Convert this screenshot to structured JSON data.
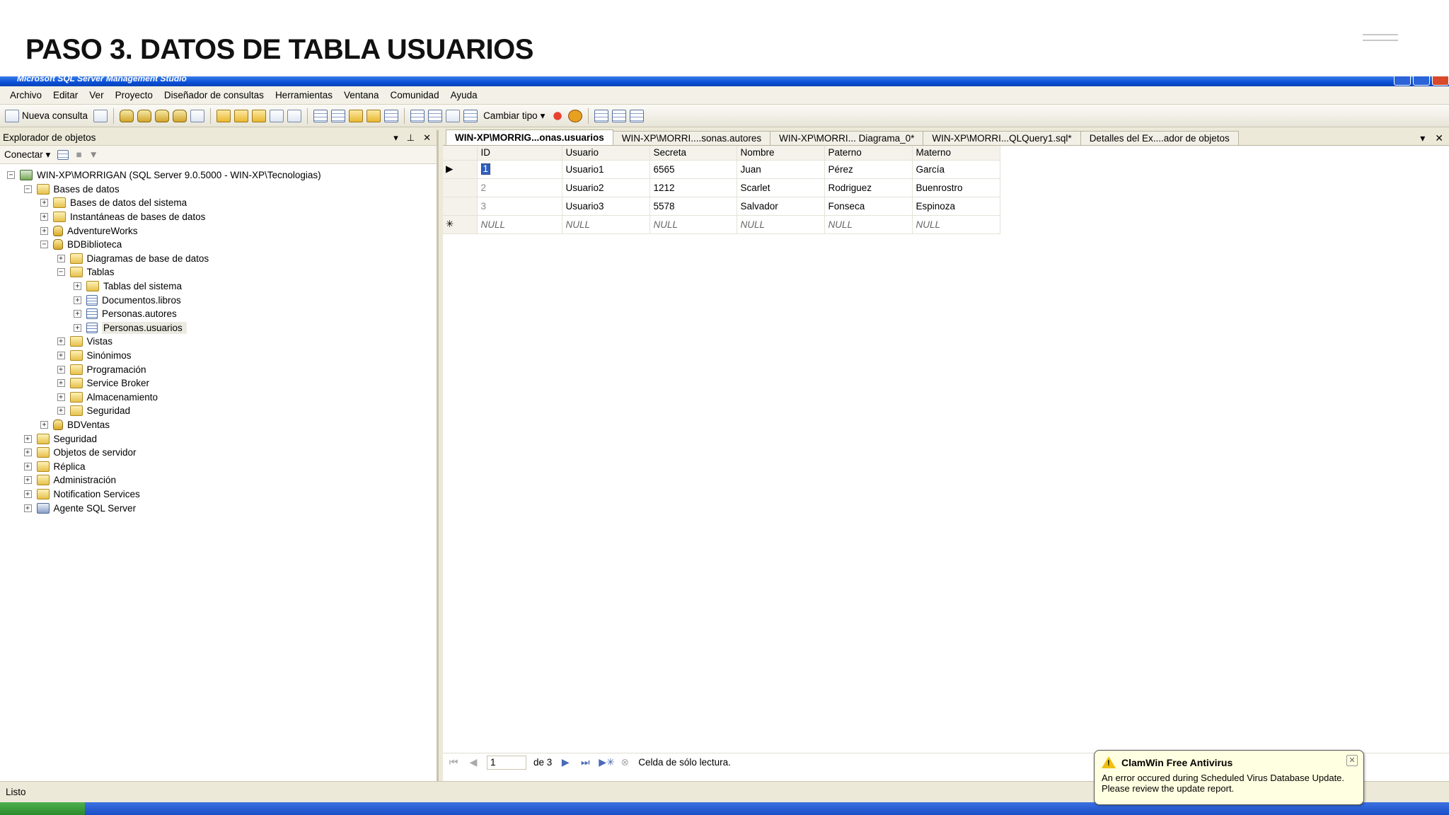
{
  "slide": {
    "title": "PASO 3. DATOS DE TABLA USUARIOS"
  },
  "window": {
    "title": "Microsoft SQL Server Management Studio"
  },
  "menu": [
    "Archivo",
    "Editar",
    "Ver",
    "Proyecto",
    "Diseñador de consultas",
    "Herramientas",
    "Ventana",
    "Comunidad",
    "Ayuda"
  ],
  "toolbar": {
    "new_query": "Nueva consulta",
    "change_type": "Cambiar tipo"
  },
  "object_explorer": {
    "title": "Explorador de objetos",
    "connect": "Conectar",
    "tree": [
      {
        "label": "WIN-XP\\MORRIGAN (SQL Server 9.0.5000 - WIN-XP\\Tecnologias)",
        "icon": "server",
        "level": 0,
        "exp": "−"
      },
      {
        "label": "Bases de datos",
        "icon": "folder",
        "level": 1,
        "exp": "−"
      },
      {
        "label": "Bases de datos del sistema",
        "icon": "folder",
        "level": 2,
        "exp": "+"
      },
      {
        "label": "Instantáneas de bases de datos",
        "icon": "folder",
        "level": 2,
        "exp": "+"
      },
      {
        "label": "AdventureWorks",
        "icon": "dbi",
        "level": 2,
        "exp": "+"
      },
      {
        "label": "BDBiblioteca",
        "icon": "dbi",
        "level": 2,
        "exp": "−"
      },
      {
        "label": "Diagramas de base de datos",
        "icon": "folder",
        "level": 3,
        "exp": "+"
      },
      {
        "label": "Tablas",
        "icon": "folder",
        "level": 3,
        "exp": "−"
      },
      {
        "label": "Tablas del sistema",
        "icon": "folder",
        "level": 4,
        "exp": "+"
      },
      {
        "label": "Documentos.libros",
        "icon": "table",
        "level": 4,
        "exp": "+"
      },
      {
        "label": "Personas.autores",
        "icon": "table",
        "level": 4,
        "exp": "+"
      },
      {
        "label": "Personas.usuarios",
        "icon": "table",
        "level": 4,
        "exp": "+",
        "selected": true
      },
      {
        "label": "Vistas",
        "icon": "folder",
        "level": 3,
        "exp": "+"
      },
      {
        "label": "Sinónimos",
        "icon": "folder",
        "level": 3,
        "exp": "+"
      },
      {
        "label": "Programación",
        "icon": "folder",
        "level": 3,
        "exp": "+"
      },
      {
        "label": "Service Broker",
        "icon": "folder",
        "level": 3,
        "exp": "+"
      },
      {
        "label": "Almacenamiento",
        "icon": "folder",
        "level": 3,
        "exp": "+"
      },
      {
        "label": "Seguridad",
        "icon": "folder",
        "level": 3,
        "exp": "+"
      },
      {
        "label": "BDVentas",
        "icon": "dbi",
        "level": 2,
        "exp": "+"
      },
      {
        "label": "Seguridad",
        "icon": "folder",
        "level": 1,
        "exp": "+"
      },
      {
        "label": "Objetos de servidor",
        "icon": "folder",
        "level": 1,
        "exp": "+"
      },
      {
        "label": "Réplica",
        "icon": "folder",
        "level": 1,
        "exp": "+"
      },
      {
        "label": "Administración",
        "icon": "folder",
        "level": 1,
        "exp": "+"
      },
      {
        "label": "Notification Services",
        "icon": "folder",
        "level": 1,
        "exp": "+"
      },
      {
        "label": "Agente SQL Server",
        "icon": "agent",
        "level": 1,
        "exp": "+"
      }
    ]
  },
  "tabs": [
    {
      "label": "WIN-XP\\MORRIG...onas.usuarios",
      "active": true
    },
    {
      "label": "WIN-XP\\MORRI....sonas.autores"
    },
    {
      "label": "WIN-XP\\MORRI... Diagrama_0*"
    },
    {
      "label": "WIN-XP\\MORRI...QLQuery1.sql*"
    },
    {
      "label": "Detalles del Ex....ador de objetos"
    }
  ],
  "grid": {
    "columns": [
      "ID",
      "Usuario",
      "Secreta",
      "Nombre",
      "Paterno",
      "Materno"
    ],
    "rows": [
      [
        "1",
        "Usuario1",
        "6565",
        "Juan",
        "Pérez",
        "García"
      ],
      [
        "2",
        "Usuario2",
        "1212",
        "Scarlet",
        "Rodriguez",
        "Buenrostro"
      ],
      [
        "3",
        "Usuario3",
        "5578",
        "Salvador",
        "Fonseca",
        "Espinoza"
      ]
    ],
    "new_row": [
      "NULL",
      "NULL",
      "NULL",
      "NULL",
      "NULL",
      "NULL"
    ]
  },
  "navigator": {
    "page": "1",
    "of_label": "de 3",
    "status": "Celda de sólo lectura."
  },
  "statusbar": {
    "text": "Listo"
  },
  "balloon": {
    "title": "ClamWin Free Antivirus",
    "line1": "An error occured during Scheduled Virus Database Update.",
    "line2": "Please review the update report."
  }
}
